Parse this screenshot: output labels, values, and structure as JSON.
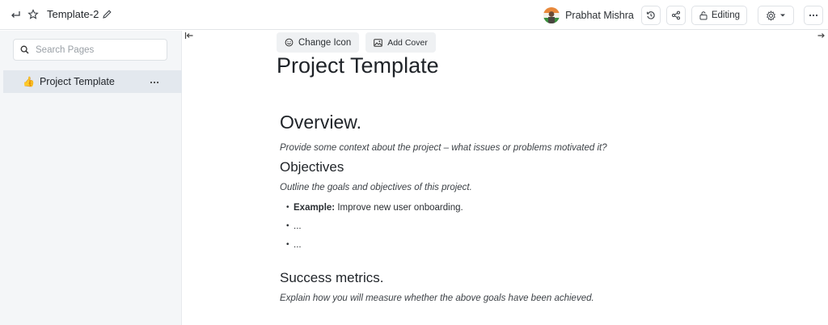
{
  "header": {
    "doc_title": "Template-2",
    "user_name": "Prabhat Mishra",
    "editing_label": "Editing"
  },
  "sidebar": {
    "search_placeholder": "Search Pages",
    "pages": [
      {
        "emoji": "👍",
        "label": "Project Template"
      }
    ]
  },
  "editor": {
    "change_icon_label": "Change Icon",
    "add_cover_label": "Add Cover",
    "page_title": "Project Template",
    "sections": {
      "overview_heading": "Overview.",
      "overview_text": "Provide some context about the project – what issues or problems motivated it?",
      "objectives_heading": "Objectives",
      "objectives_text": "Outline the goals and objectives of this project.",
      "bullet_1_bold": "Example:",
      "bullet_1_text": " Improve new user onboarding.",
      "bullet_2": "...",
      "bullet_3": "...",
      "metrics_heading": "Success metrics.",
      "metrics_text": "Explain how you will measure whether the above goals have been achieved."
    }
  },
  "colors": {
    "sidebar_bg": "#f4f6f8",
    "selected_item_bg": "#e3e8ee",
    "button_bg": "#eff1f3"
  }
}
